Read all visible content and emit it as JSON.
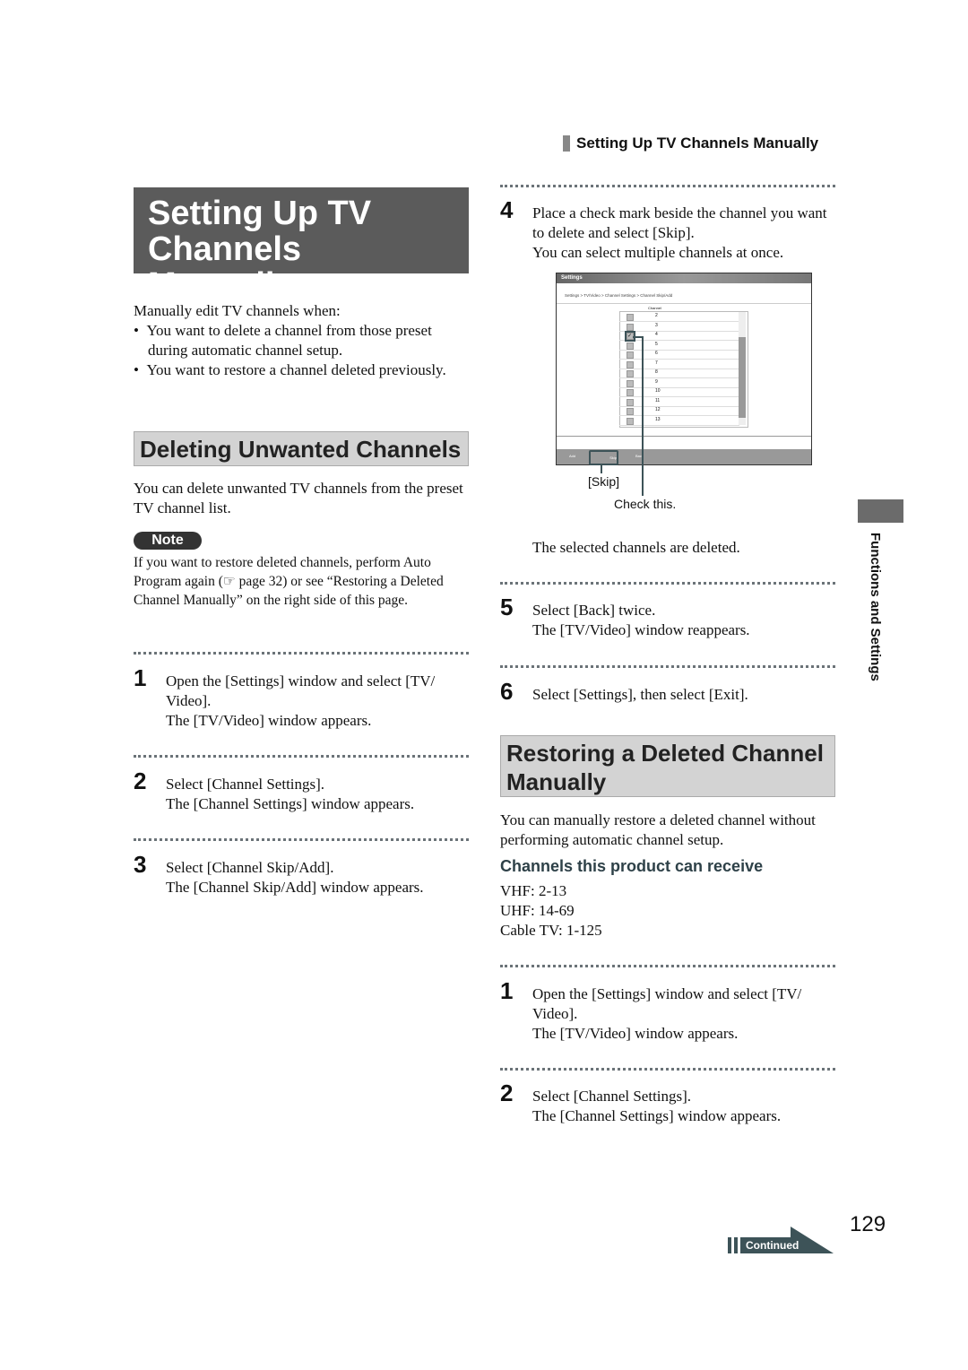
{
  "running_header": "Setting Up TV Channels Manually",
  "title": [
    "Setting Up TV",
    "Channels Manually"
  ],
  "intro": {
    "lead": "Manually edit TV channels when:",
    "bullets": [
      "You want to delete a channel from those preset during automatic channel setup.",
      "You want to restore a channel deleted previously."
    ]
  },
  "section1": {
    "heading": "Deleting Unwanted Channels",
    "text": "You can delete unwanted TV channels from the preset TV channel list.",
    "note_label": "Note",
    "note_text": "If you want to restore deleted channels, perform Auto Program again (☞ page 32) or see “Restoring a Deleted Channel Manually” on the right side of this page.",
    "steps": [
      {
        "num": "1",
        "text": "Open the [Settings] window and select [TV/ Video].",
        "result": "The [TV/Video] window appears."
      },
      {
        "num": "2",
        "text": "Select [Channel Settings].",
        "result": "The [Channel Settings] window appears."
      },
      {
        "num": "3",
        "text": "Select [Channel Skip/Add].",
        "result": "The [Channel Skip/Add] window appears."
      },
      {
        "num": "4",
        "text": "Place a check mark beside the channel you want to delete and select [Skip].",
        "result": "You can select multiple channels at once."
      },
      {
        "num": "5",
        "text": "Select [Back] twice.",
        "result": "The [TV/Video] window reappears."
      },
      {
        "num": "6",
        "text": "Select [Settings], then select [Exit].",
        "result": ""
      }
    ],
    "after_figure": "The selected channels are deleted."
  },
  "figure": {
    "window_title": "Settings",
    "breadcrumb": "Settings > TV/Video > Channel Settings > Channel Skip/Add",
    "column": "Channel",
    "channels": [
      "2",
      "3",
      "4",
      "5",
      "6",
      "7",
      "8",
      "9",
      "10",
      "11",
      "12",
      "13"
    ],
    "checked": "4",
    "buttons": [
      "Add",
      "Skip",
      "Back"
    ],
    "callout_skip": "[Skip]",
    "callout_check": "Check this."
  },
  "section2": {
    "heading": "Restoring a Deleted Channel Manually",
    "text": "You can manually restore a deleted channel without performing automatic channel setup.",
    "subheading": "Channels this product can receive",
    "ranges": [
      "VHF: 2-13",
      "UHF: 14-69",
      "Cable TV: 1-125"
    ],
    "steps": [
      {
        "num": "1",
        "text": "Open the [Settings] window and select [TV/ Video].",
        "result": "The [TV/Video] window appears."
      },
      {
        "num": "2",
        "text": "Select [Channel Settings].",
        "result": "The [Channel Settings] window appears."
      }
    ]
  },
  "side_tab": "Functions and Settings",
  "page_number": "129",
  "continued": "Continued"
}
